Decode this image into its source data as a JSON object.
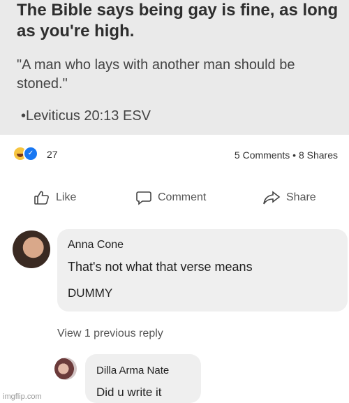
{
  "post": {
    "headline": "The Bible says being gay is fine, as long as you're high.",
    "quote": "\"A man who lays with another man should be stoned.\"",
    "citation": "•Leviticus 20:13 ESV"
  },
  "reactions": {
    "count": "27",
    "comments": "5 Comments",
    "separator": "•",
    "shares": "8 Shares"
  },
  "actions": {
    "like": "Like",
    "comment": "Comment",
    "share": "Share"
  },
  "comments": [
    {
      "author": "Anna Cone",
      "line1": "That's not what that verse means",
      "line2": "DUMMY"
    }
  ],
  "view_previous_replies": "View 1 previous reply",
  "reply": {
    "author": "Dilla Arma Nate",
    "text": "Did u write it"
  },
  "watermark": "imgflip.com",
  "colors": {
    "like_blue": "#1877f2",
    "haha_yellow": "#f7c540",
    "bubble_gray": "#efefef"
  }
}
